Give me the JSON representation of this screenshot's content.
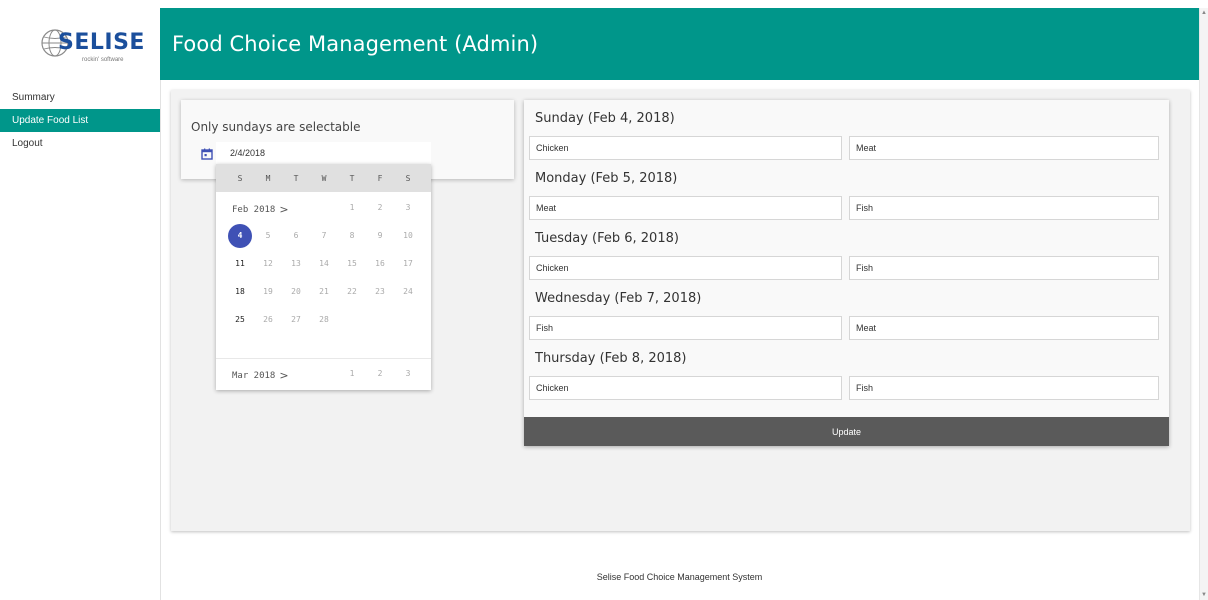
{
  "app": {
    "logo_text": "SELISE",
    "logo_sub": "rockin' software",
    "title": "Food Choice Management (Admin)",
    "footer": "Selise Food Choice Management System",
    "accent_color": "#00968a",
    "selected_color": "#3f51b5"
  },
  "sidebar": {
    "items": [
      {
        "label": "Summary",
        "active": false
      },
      {
        "label": "Update Food List",
        "active": true
      },
      {
        "label": "Logout",
        "active": false
      }
    ]
  },
  "date_picker": {
    "hint": "Only sundays are selectable",
    "icon": "calendar-icon",
    "value": "2/4/2018",
    "weekdays": [
      "S",
      "M",
      "T",
      "W",
      "T",
      "F",
      "S"
    ],
    "months": [
      {
        "label": "Feb 2018",
        "chevron": ">",
        "weeks": [
          [
            "",
            "",
            "",
            "",
            "1",
            "2",
            "3"
          ],
          [
            "4",
            "5",
            "6",
            "7",
            "8",
            "9",
            "10"
          ],
          [
            "11",
            "12",
            "13",
            "14",
            "15",
            "16",
            "17"
          ],
          [
            "18",
            "19",
            "20",
            "21",
            "22",
            "23",
            "24"
          ],
          [
            "25",
            "26",
            "27",
            "28",
            "",
            "",
            ""
          ]
        ],
        "selected": "4"
      },
      {
        "label": "Mar 2018",
        "chevron": ">",
        "weeks": [
          [
            "",
            "",
            "",
            "",
            "1",
            "2",
            "3"
          ]
        ]
      }
    ]
  },
  "food_list": {
    "days": [
      {
        "heading": "Sunday (Feb 4, 2018)",
        "choice1": "Chicken",
        "choice2": "Meat"
      },
      {
        "heading": "Monday (Feb 5, 2018)",
        "choice1": "Meat",
        "choice2": "Fish"
      },
      {
        "heading": "Tuesday (Feb 6, 2018)",
        "choice1": "Chicken",
        "choice2": "Fish"
      },
      {
        "heading": "Wednesday (Feb 7, 2018)",
        "choice1": "Fish",
        "choice2": "Meat"
      },
      {
        "heading": "Thursday (Feb 8, 2018)",
        "choice1": "Chicken",
        "choice2": "Fish"
      }
    ],
    "update_label": "Update"
  }
}
